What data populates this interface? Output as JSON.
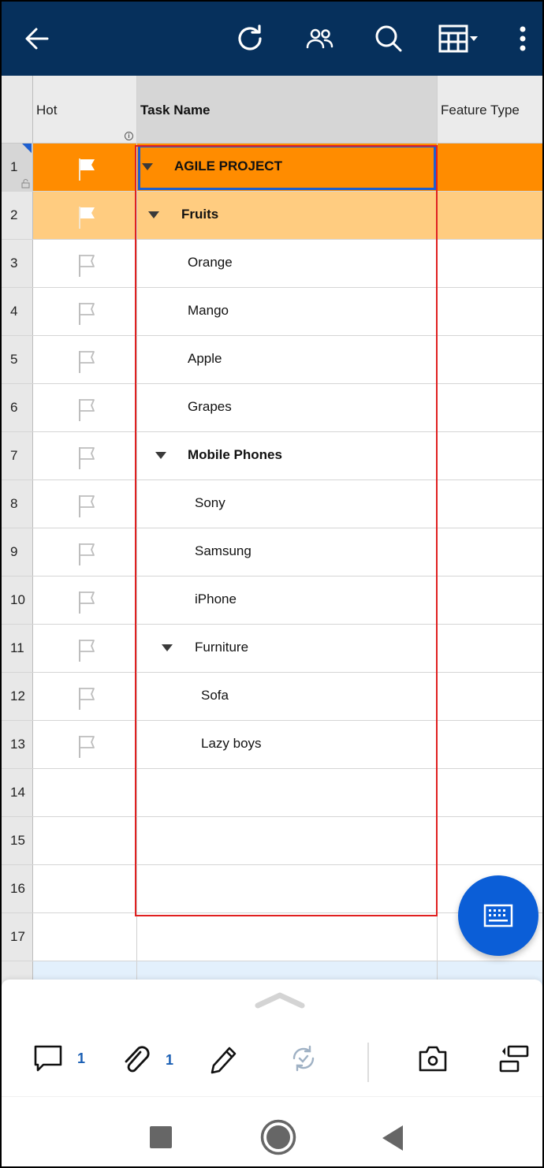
{
  "topbar": {
    "back_icon": "arrow-left-icon",
    "actions": [
      {
        "name": "refresh",
        "icon": "refresh-icon"
      },
      {
        "name": "share",
        "icon": "people-icon"
      },
      {
        "name": "search",
        "icon": "search-icon"
      },
      {
        "name": "view",
        "icon": "grid-view-dropdown-icon"
      },
      {
        "name": "more",
        "icon": "more-vertical-icon"
      }
    ]
  },
  "columns": {
    "hot": "Hot",
    "task_name": "Task Name",
    "feature_type": "Feature Type"
  },
  "rows": [
    {
      "num": "1",
      "task": "AGILE PROJECT",
      "level": 0,
      "bold": true,
      "collapsible": true,
      "flag": "white",
      "locked": true
    },
    {
      "num": "2",
      "task": "Fruits",
      "level": 1,
      "bold": true,
      "collapsible": true,
      "flag": "white"
    },
    {
      "num": "3",
      "task": "Orange",
      "level": 2,
      "bold": false,
      "flag": "outline"
    },
    {
      "num": "4",
      "task": "Mango",
      "level": 2,
      "bold": false,
      "flag": "outline"
    },
    {
      "num": "5",
      "task": "Apple",
      "level": 2,
      "bold": false,
      "flag": "outline"
    },
    {
      "num": "6",
      "task": "Grapes",
      "level": 2,
      "bold": false,
      "flag": "outline"
    },
    {
      "num": "7",
      "task": "Mobile Phones",
      "level": 2,
      "bold": true,
      "collapsible": true,
      "flag": "outline"
    },
    {
      "num": "8",
      "task": "Sony",
      "level": 3,
      "bold": false,
      "flag": "outline"
    },
    {
      "num": "9",
      "task": "Samsung",
      "level": 3,
      "bold": false,
      "flag": "outline"
    },
    {
      "num": "10",
      "task": "iPhone",
      "level": 3,
      "bold": false,
      "flag": "outline"
    },
    {
      "num": "11",
      "task": "Furniture",
      "level": 3,
      "bold": false,
      "collapsible": true,
      "flag": "outline"
    },
    {
      "num": "12",
      "task": "Sofa",
      "level": 4,
      "bold": false,
      "flag": "outline"
    },
    {
      "num": "13",
      "task": "Lazy boys",
      "level": 4,
      "bold": false,
      "flag": "outline"
    },
    {
      "num": "14",
      "task": "",
      "flag": "none"
    },
    {
      "num": "15",
      "task": "",
      "flag": "none"
    },
    {
      "num": "16",
      "task": "",
      "flag": "none"
    },
    {
      "num": "17",
      "task": "",
      "flag": "none"
    }
  ],
  "colors": {
    "topbar": "#06305c",
    "level0_row": "#ff8c00",
    "level1_row": "#ffcc80",
    "selection": "#1e5fcf",
    "range_highlight": "#e02020",
    "fab": "#0b5ed7",
    "count": "#1a5fb4"
  },
  "fab": {
    "icon": "keyboard-icon"
  },
  "bottom_toolbar": {
    "comments_count": "1",
    "attachments_count": "1",
    "items": [
      "comment-icon",
      "paperclip-icon",
      "pencil-icon",
      "sync-check-icon",
      "camera-icon",
      "row-layout-icon"
    ]
  },
  "system_nav": [
    "recents-button",
    "home-button",
    "back-button"
  ]
}
